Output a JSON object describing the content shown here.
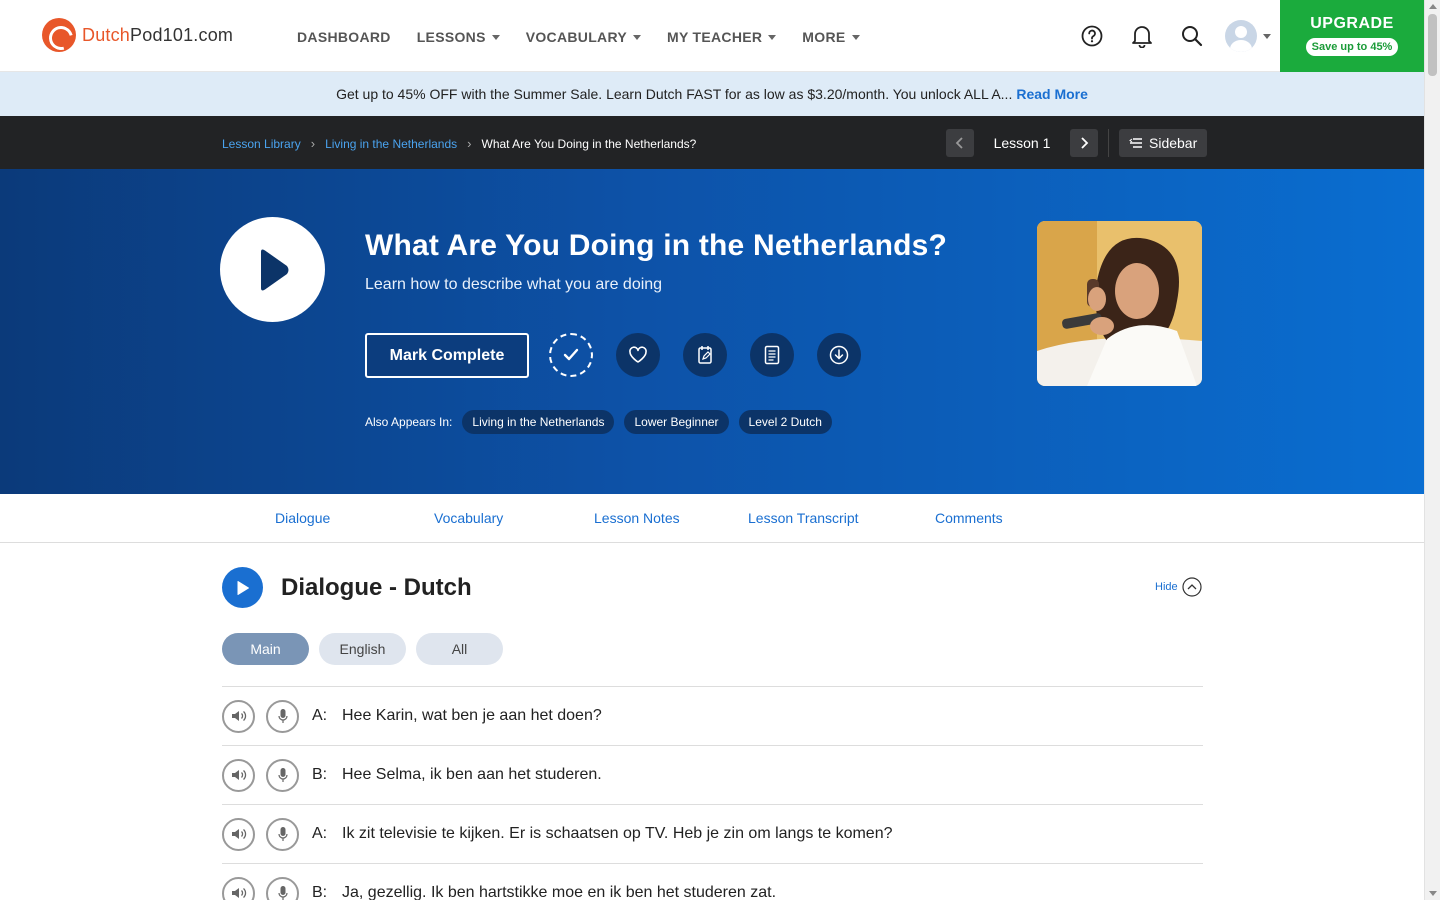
{
  "brand": {
    "name_accent": "Dutch",
    "name_rest": "Pod101.com",
    "accent_color": "#e8572a"
  },
  "nav": {
    "items": [
      {
        "label": "DASHBOARD",
        "dropdown": false
      },
      {
        "label": "LESSONS",
        "dropdown": true
      },
      {
        "label": "VOCABULARY",
        "dropdown": true
      },
      {
        "label": "MY TEACHER",
        "dropdown": true
      },
      {
        "label": "MORE",
        "dropdown": true
      }
    ],
    "icons": [
      "help-icon",
      "bell-icon",
      "search-icon"
    ],
    "upgrade": {
      "title": "UPGRADE",
      "badge": "Save up to 45%",
      "color": "#1bab3d"
    }
  },
  "promo": {
    "text": "Get up to 45% OFF with the Summer Sale. Learn Dutch FAST for as low as $3.20/month. You unlock ALL A...",
    "link": "Read More"
  },
  "breadcrumb": {
    "items": [
      "Lesson Library",
      "Living in the Netherlands"
    ],
    "current": "What Are You Doing in the Netherlands?",
    "lesson_label": "Lesson 1",
    "sidebar_label": "Sidebar"
  },
  "hero": {
    "title": "What Are You Doing in the Netherlands?",
    "subtitle": "Learn how to describe what you are doing",
    "mark_complete": "Mark Complete",
    "action_icons": [
      "checkmark-icon",
      "heart-icon",
      "notes-edit-icon",
      "pdf-document-icon",
      "download-icon"
    ],
    "also_label": "Also Appears In:",
    "tags": [
      "Living in the Netherlands",
      "Lower Beginner",
      "Level 2 Dutch"
    ]
  },
  "tabs": [
    "Dialogue",
    "Vocabulary",
    "Lesson Notes",
    "Lesson Transcript",
    "Comments"
  ],
  "dialogue": {
    "title": "Dialogue - Dutch",
    "hide_label": "Hide",
    "modes": [
      "Main",
      "English",
      "All"
    ],
    "active_mode": "Main",
    "lines": [
      {
        "speaker": "A:",
        "text": "Hee Karin, wat ben je aan het doen?"
      },
      {
        "speaker": "B:",
        "text": "Hee Selma, ik ben aan het studeren."
      },
      {
        "speaker": "A:",
        "text": "Ik zit televisie te kijken. Er is schaatsen op TV. Heb je zin om langs te komen?"
      },
      {
        "speaker": "B:",
        "text": "Ja, gezellig. Ik ben hartstikke moe en ik ben het studeren zat."
      }
    ]
  }
}
